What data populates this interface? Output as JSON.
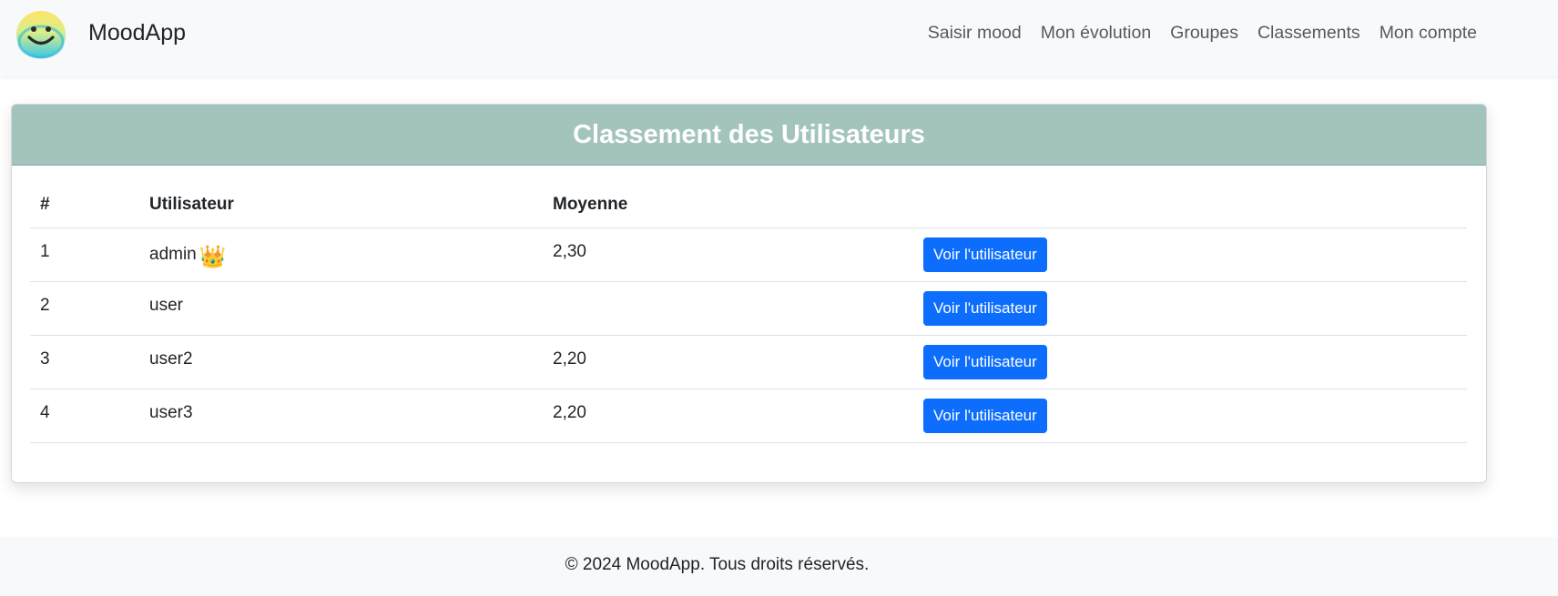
{
  "colors": {
    "header_bg": "#a3c4bc",
    "button_bg": "#0d6efd",
    "navbar_bg": "#f8f9fa",
    "crown": "#f5c400"
  },
  "navbar": {
    "brand": "MoodApp",
    "logo_icon": "smiley-face-icon",
    "links": [
      {
        "label": "Saisir mood"
      },
      {
        "label": "Mon évolution"
      },
      {
        "label": "Groupes"
      },
      {
        "label": "Classements"
      },
      {
        "label": "Mon compte"
      }
    ]
  },
  "ranking": {
    "title": "Classement des Utilisateurs",
    "columns": [
      "#",
      "Utilisateur",
      "Moyenne",
      ""
    ],
    "rows": [
      {
        "rank": "1",
        "user": "admin",
        "crown": "👑",
        "average": "2,30",
        "action": "Voir l'utilisateur"
      },
      {
        "rank": "2",
        "user": "user",
        "crown": "",
        "average": "",
        "action": "Voir l'utilisateur"
      },
      {
        "rank": "3",
        "user": "user2",
        "crown": "",
        "average": "2,20",
        "action": "Voir l'utilisateur"
      },
      {
        "rank": "4",
        "user": "user3",
        "crown": "",
        "average": "2,20",
        "action": "Voir l'utilisateur"
      }
    ]
  },
  "footer": {
    "text": "© 2024 MoodApp. Tous droits réservés."
  }
}
